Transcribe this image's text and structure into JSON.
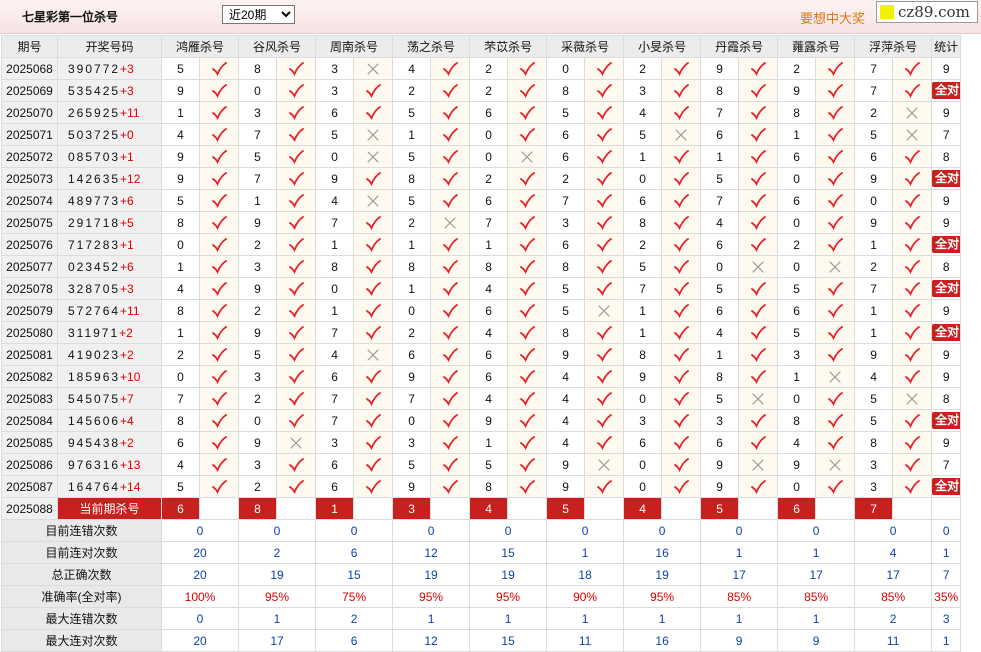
{
  "page": {
    "title": "七星彩第一位杀号",
    "period_select": {
      "selected": "近20期",
      "options": [
        "近20期"
      ]
    },
    "slogan": "要想中大奖",
    "site": "cz89.com"
  },
  "table": {
    "headers": {
      "issue": "期号",
      "numbers": "开奖号码",
      "stat": "统计"
    },
    "experts": [
      "鸿雁杀号",
      "谷风杀号",
      "周南杀号",
      "荡之杀号",
      "芣苡杀号",
      "采薇杀号",
      "小旻杀号",
      "丹霞杀号",
      "蕹露杀号",
      "浮萍杀号"
    ],
    "rows": [
      {
        "issue": "2025068",
        "numbers": "390772",
        "sum": "+3",
        "kills": [
          "5",
          "8",
          "3",
          "4",
          "2",
          "0",
          "2",
          "9",
          "2",
          "7"
        ],
        "marks": [
          1,
          1,
          0,
          1,
          1,
          1,
          1,
          1,
          1,
          1
        ],
        "stat": "9"
      },
      {
        "issue": "2025069",
        "numbers": "535425",
        "sum": "+3",
        "kills": [
          "9",
          "0",
          "3",
          "2",
          "2",
          "8",
          "3",
          "8",
          "9",
          "7"
        ],
        "marks": [
          1,
          1,
          1,
          1,
          1,
          1,
          1,
          1,
          1,
          1
        ],
        "stat": "全对"
      },
      {
        "issue": "2025070",
        "numbers": "265925",
        "sum": "+11",
        "kills": [
          "1",
          "3",
          "6",
          "5",
          "6",
          "5",
          "4",
          "7",
          "8",
          "2"
        ],
        "marks": [
          1,
          1,
          1,
          1,
          1,
          1,
          1,
          1,
          1,
          0
        ],
        "stat": "9"
      },
      {
        "issue": "2025071",
        "numbers": "503725",
        "sum": "+0",
        "kills": [
          "4",
          "7",
          "5",
          "1",
          "0",
          "6",
          "5",
          "6",
          "1",
          "5"
        ],
        "marks": [
          1,
          1,
          0,
          1,
          1,
          1,
          0,
          1,
          1,
          0
        ],
        "stat": "7"
      },
      {
        "issue": "2025072",
        "numbers": "085703",
        "sum": "+1",
        "kills": [
          "9",
          "5",
          "0",
          "5",
          "0",
          "6",
          "1",
          "1",
          "6",
          "6"
        ],
        "marks": [
          1,
          1,
          0,
          1,
          0,
          1,
          1,
          1,
          1,
          1
        ],
        "stat": "8"
      },
      {
        "issue": "2025073",
        "numbers": "142635",
        "sum": "+12",
        "kills": [
          "9",
          "7",
          "9",
          "8",
          "2",
          "2",
          "0",
          "5",
          "0",
          "9"
        ],
        "marks": [
          1,
          1,
          1,
          1,
          1,
          1,
          1,
          1,
          1,
          1
        ],
        "stat": "全对"
      },
      {
        "issue": "2025074",
        "numbers": "489773",
        "sum": "+6",
        "kills": [
          "5",
          "1",
          "4",
          "5",
          "6",
          "7",
          "6",
          "7",
          "6",
          "0"
        ],
        "marks": [
          1,
          1,
          0,
          1,
          1,
          1,
          1,
          1,
          1,
          1
        ],
        "stat": "9"
      },
      {
        "issue": "2025075",
        "numbers": "291718",
        "sum": "+5",
        "kills": [
          "8",
          "9",
          "7",
          "2",
          "7",
          "3",
          "8",
          "4",
          "0",
          "9"
        ],
        "marks": [
          1,
          1,
          1,
          0,
          1,
          1,
          1,
          1,
          1,
          1
        ],
        "stat": "9"
      },
      {
        "issue": "2025076",
        "numbers": "717283",
        "sum": "+1",
        "kills": [
          "0",
          "2",
          "1",
          "1",
          "1",
          "6",
          "2",
          "6",
          "2",
          "1"
        ],
        "marks": [
          1,
          1,
          1,
          1,
          1,
          1,
          1,
          1,
          1,
          1
        ],
        "stat": "全对"
      },
      {
        "issue": "2025077",
        "numbers": "023452",
        "sum": "+6",
        "kills": [
          "1",
          "3",
          "8",
          "8",
          "8",
          "8",
          "5",
          "0",
          "0",
          "2"
        ],
        "marks": [
          1,
          1,
          1,
          1,
          1,
          1,
          1,
          0,
          0,
          1
        ],
        "stat": "8"
      },
      {
        "issue": "2025078",
        "numbers": "328705",
        "sum": "+3",
        "kills": [
          "4",
          "9",
          "0",
          "1",
          "4",
          "5",
          "7",
          "5",
          "5",
          "7"
        ],
        "marks": [
          1,
          1,
          1,
          1,
          1,
          1,
          1,
          1,
          1,
          1
        ],
        "stat": "全对"
      },
      {
        "issue": "2025079",
        "numbers": "572764",
        "sum": "+11",
        "kills": [
          "8",
          "2",
          "1",
          "0",
          "6",
          "5",
          "1",
          "6",
          "6",
          "1"
        ],
        "marks": [
          1,
          1,
          1,
          1,
          1,
          0,
          1,
          1,
          1,
          1
        ],
        "stat": "9"
      },
      {
        "issue": "2025080",
        "numbers": "311971",
        "sum": "+2",
        "kills": [
          "1",
          "9",
          "7",
          "2",
          "4",
          "8",
          "1",
          "4",
          "5",
          "1"
        ],
        "marks": [
          1,
          1,
          1,
          1,
          1,
          1,
          1,
          1,
          1,
          1
        ],
        "stat": "全对"
      },
      {
        "issue": "2025081",
        "numbers": "419023",
        "sum": "+2",
        "kills": [
          "2",
          "5",
          "4",
          "6",
          "6",
          "9",
          "8",
          "1",
          "3",
          "9"
        ],
        "marks": [
          1,
          1,
          0,
          1,
          1,
          1,
          1,
          1,
          1,
          1
        ],
        "stat": "9"
      },
      {
        "issue": "2025082",
        "numbers": "185963",
        "sum": "+10",
        "kills": [
          "0",
          "3",
          "6",
          "9",
          "6",
          "4",
          "9",
          "8",
          "1",
          "4"
        ],
        "marks": [
          1,
          1,
          1,
          1,
          1,
          1,
          1,
          1,
          0,
          1
        ],
        "stat": "9"
      },
      {
        "issue": "2025083",
        "numbers": "545075",
        "sum": "+7",
        "kills": [
          "7",
          "2",
          "7",
          "7",
          "4",
          "4",
          "0",
          "5",
          "0",
          "5"
        ],
        "marks": [
          1,
          1,
          1,
          1,
          1,
          1,
          1,
          0,
          1,
          0
        ],
        "stat": "8"
      },
      {
        "issue": "2025084",
        "numbers": "145606",
        "sum": "+4",
        "kills": [
          "8",
          "0",
          "7",
          "0",
          "9",
          "4",
          "3",
          "3",
          "8",
          "5"
        ],
        "marks": [
          1,
          1,
          1,
          1,
          1,
          1,
          1,
          1,
          1,
          1
        ],
        "stat": "全对"
      },
      {
        "issue": "2025085",
        "numbers": "945438",
        "sum": "+2",
        "kills": [
          "6",
          "9",
          "3",
          "3",
          "1",
          "4",
          "6",
          "6",
          "4",
          "8"
        ],
        "marks": [
          1,
          0,
          1,
          1,
          1,
          1,
          1,
          1,
          1,
          1
        ],
        "stat": "9"
      },
      {
        "issue": "2025086",
        "numbers": "976316",
        "sum": "+13",
        "kills": [
          "4",
          "3",
          "6",
          "5",
          "5",
          "9",
          "0",
          "9",
          "9",
          "3"
        ],
        "marks": [
          1,
          1,
          1,
          1,
          1,
          0,
          1,
          0,
          0,
          1
        ],
        "stat": "7"
      },
      {
        "issue": "2025087",
        "numbers": "164764",
        "sum": "+14",
        "kills": [
          "5",
          "2",
          "6",
          "9",
          "8",
          "9",
          "0",
          "9",
          "0",
          "3"
        ],
        "marks": [
          1,
          1,
          1,
          1,
          1,
          1,
          1,
          1,
          1,
          1
        ],
        "stat": "全对"
      }
    ],
    "current": {
      "issue": "2025088",
      "label": "当前期杀号",
      "kills": [
        "6",
        "8",
        "1",
        "3",
        "4",
        "5",
        "4",
        "5",
        "6",
        "7"
      ]
    },
    "summary": [
      {
        "label": "目前连错次数",
        "values": [
          "0",
          "0",
          "0",
          "0",
          "0",
          "0",
          "0",
          "0",
          "0",
          "0"
        ],
        "stat": "0",
        "red": false
      },
      {
        "label": "目前连对次数",
        "values": [
          "20",
          "2",
          "6",
          "12",
          "15",
          "1",
          "16",
          "1",
          "1",
          "4"
        ],
        "stat": "1",
        "red": false
      },
      {
        "label": "总正确次数",
        "values": [
          "20",
          "19",
          "15",
          "19",
          "19",
          "18",
          "19",
          "17",
          "17",
          "17"
        ],
        "stat": "7",
        "red": false
      },
      {
        "label": "准确率(全对率)",
        "values": [
          "100%",
          "95%",
          "75%",
          "95%",
          "95%",
          "90%",
          "95%",
          "85%",
          "85%",
          "85%"
        ],
        "stat": "35%",
        "red": true
      },
      {
        "label": "最大连错次数",
        "values": [
          "0",
          "1",
          "2",
          "1",
          "1",
          "1",
          "1",
          "1",
          "1",
          "2"
        ],
        "stat": "3",
        "red": false
      },
      {
        "label": "最大连对次数",
        "values": [
          "20",
          "17",
          "6",
          "12",
          "15",
          "11",
          "16",
          "9",
          "9",
          "11"
        ],
        "stat": "1",
        "red": false
      }
    ]
  },
  "icons": {
    "right": "check-icon",
    "wrong": "cross-icon"
  },
  "colors": {
    "check": "#e8202a",
    "cross": "#999999",
    "highlight": "#c8201e",
    "sum_value": "#1040b0",
    "rate": "#e00000",
    "slogan": "#e07810"
  }
}
